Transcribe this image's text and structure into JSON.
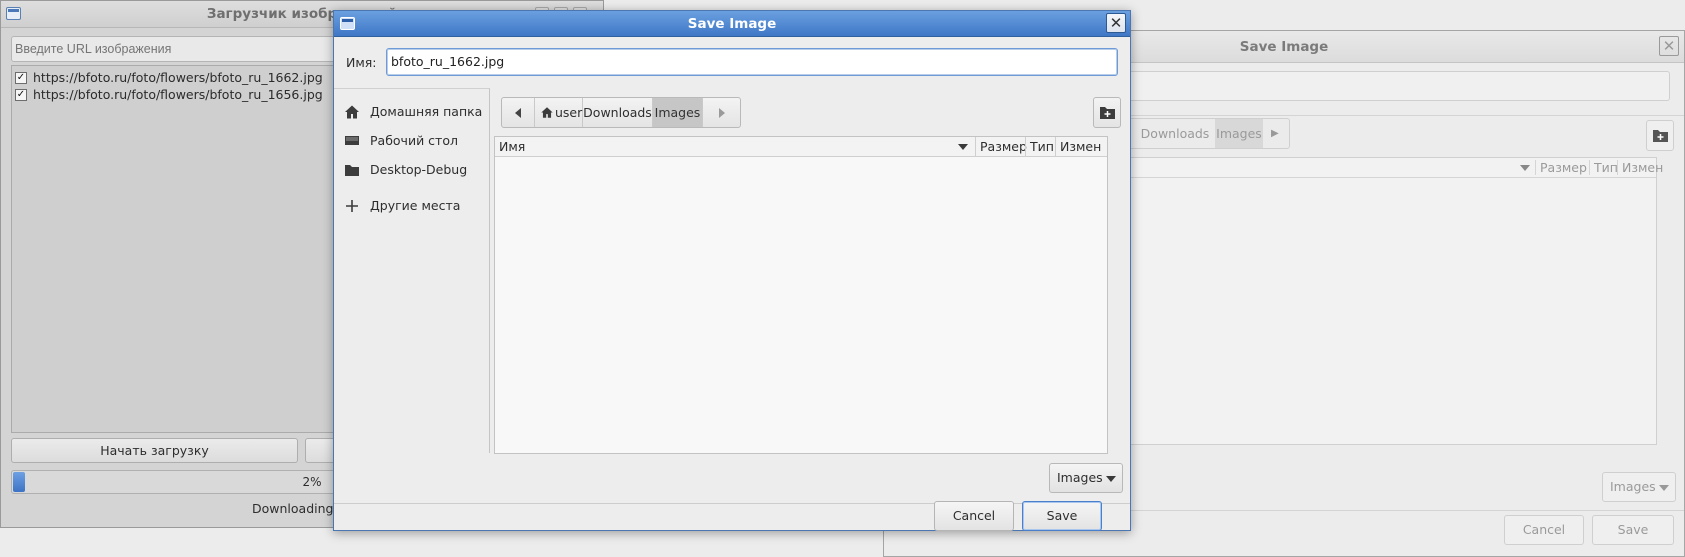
{
  "main_window": {
    "title": "Загрузчик изображений",
    "url_placeholder": "Введите URL изображения",
    "urls": [
      {
        "url": "https://bfoto.ru/foto/flowers/bfoto_ru_1662.jpg",
        "checked": true
      },
      {
        "url": "https://bfoto.ru/foto/flowers/bfoto_ru_1656.jpg",
        "checked": true
      }
    ],
    "start_button": "Начать загрузку",
    "progress": {
      "percent": 2,
      "label": "2%"
    },
    "status": "Downloading:"
  },
  "background_dialog": {
    "title": "Save Image",
    "path": [
      "Downloads",
      "Images"
    ],
    "columns": [
      "Размер",
      "Тип",
      "Измен"
    ],
    "filter": "Images",
    "cancel": "Cancel",
    "save": "Save"
  },
  "dialog": {
    "title": "Save Image",
    "name_label": "Имя:",
    "filename": "bfoto_ru_1662.jpg",
    "places": [
      {
        "label": "Домашняя папка",
        "icon": "home-icon"
      },
      {
        "label": "Рабочий стол",
        "icon": "desktop-icon"
      },
      {
        "label": "Desktop-Debug",
        "icon": "folder-icon"
      },
      {
        "label": "Другие места",
        "icon": "plus-icon"
      }
    ],
    "path": {
      "home": "user",
      "segments": [
        "Downloads",
        "Images"
      ]
    },
    "columns": {
      "name": "Имя",
      "size": "Размер",
      "type": "Тип",
      "modified": "Измен"
    },
    "filter": "Images",
    "cancel": "Cancel",
    "save": "Save",
    "accent": "#4a7fcb"
  }
}
